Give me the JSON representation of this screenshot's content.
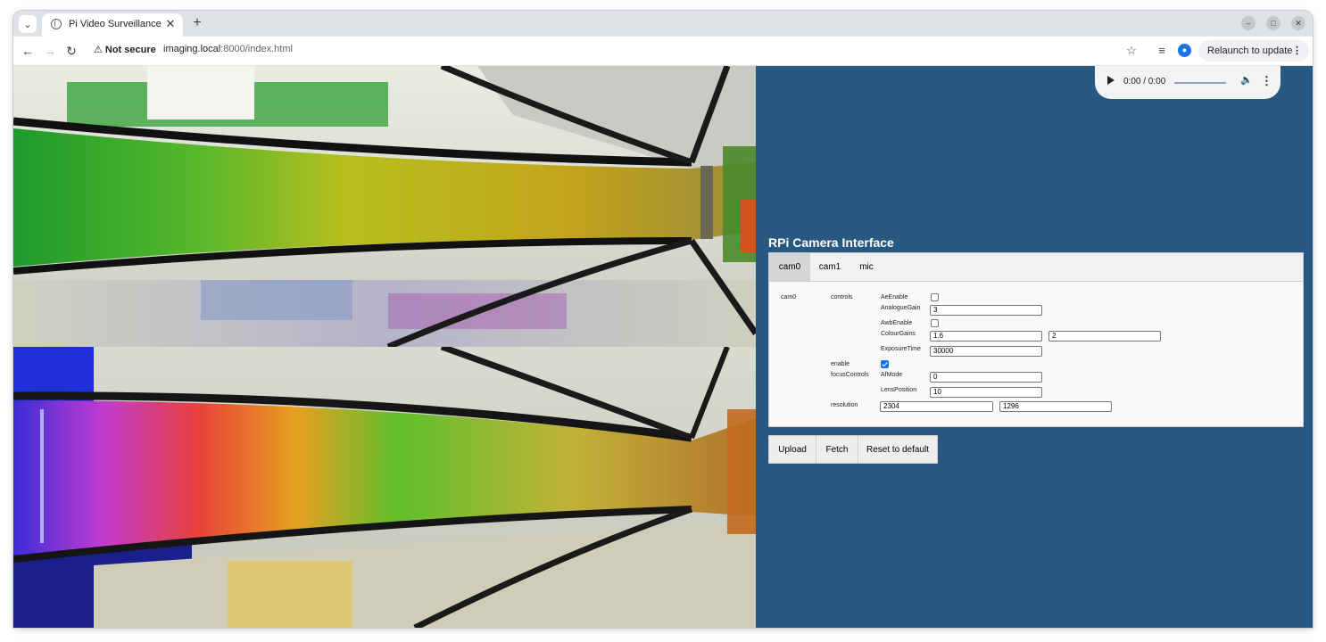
{
  "browser": {
    "tab_title": "Pi Video Surveillance",
    "tab_close": "✕",
    "new_tab": "+",
    "tab_search": "⌄",
    "security_label": "Not secure",
    "security_icon": "⚠",
    "url_host": "imaging.local",
    "url_rest": ":8000/index.html",
    "relaunch_label": "Relaunch to update",
    "menu_dots": "⋮",
    "back": "←",
    "forward": "→",
    "reload": "↻",
    "bookmark_star": "☆",
    "media_icon": "≡",
    "window_min": "–",
    "window_max": "□",
    "window_close": "✕"
  },
  "audio": {
    "time": "0:00 / 0:00",
    "volume_icon": "🔈",
    "more_icon": "⋮"
  },
  "page": {
    "heading": "RPi Camera Interface",
    "tabs": [
      "cam0",
      "cam1",
      "mic"
    ],
    "active_tab": "cam0"
  },
  "config": {
    "section": "cam0",
    "controls_label": "controls",
    "ae_enable_label": "AeEnable",
    "ae_enable_checked": false,
    "analogue_gain_label": "AnalogueGain",
    "analogue_gain": "3",
    "awb_enable_label": "AwbEnable",
    "awb_enable_checked": false,
    "colour_gains_label": "ColourGains",
    "colour_gains": [
      "1.6",
      "2"
    ],
    "exposure_time_label": "ExposureTime",
    "exposure_time": "30000",
    "enable_label": "enable",
    "enable_checked": true,
    "focus_controls_label": "focusControls",
    "af_mode_label": "AfMode",
    "af_mode": "0",
    "lens_position_label": "LensPosition",
    "lens_position": "10",
    "resolution_label": "resolution",
    "resolution": [
      "2304",
      "1296"
    ]
  },
  "actions": {
    "upload": "Upload",
    "fetch": "Fetch",
    "reset": "Reset to default"
  }
}
